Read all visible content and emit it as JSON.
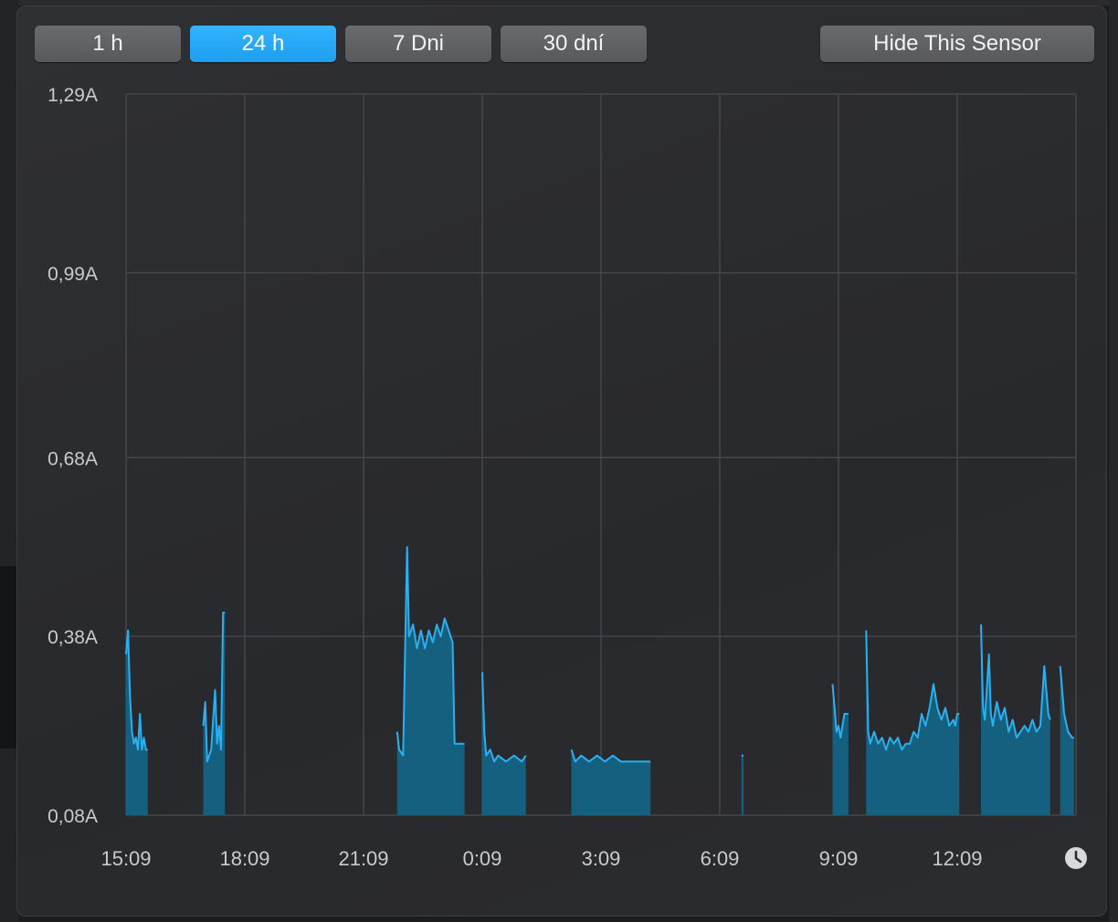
{
  "toolbar": {
    "buttons": [
      {
        "label": "1 h",
        "active": false
      },
      {
        "label": "24 h",
        "active": true
      },
      {
        "label": "7 Dni",
        "active": false
      },
      {
        "label": "30 dní",
        "active": false
      }
    ],
    "hide_label": "Hide This Sensor"
  },
  "colors": {
    "accent": "#1d9ef0",
    "series_line": "#2ab0f0",
    "series_fill": "#15607f"
  },
  "icons": {
    "history": "clock-icon"
  },
  "chart_data": {
    "type": "area",
    "title": "",
    "xlabel": "",
    "ylabel": "",
    "y_unit": "A",
    "ylim": [
      0.08,
      1.29
    ],
    "yticks": [
      {
        "value": 1.29,
        "label": "1,29A"
      },
      {
        "value": 0.99,
        "label": "0,99A"
      },
      {
        "value": 0.68,
        "label": "0,68A"
      },
      {
        "value": 0.38,
        "label": "0,38A"
      },
      {
        "value": 0.08,
        "label": "0,08A"
      }
    ],
    "x_unit": "hours",
    "xlim": [
      0,
      24
    ],
    "xticks": [
      {
        "value": 0,
        "label": "15:09"
      },
      {
        "value": 3,
        "label": "18:09"
      },
      {
        "value": 6,
        "label": "21:09"
      },
      {
        "value": 9,
        "label": "0:09"
      },
      {
        "value": 12,
        "label": "3:09"
      },
      {
        "value": 15,
        "label": "6:09"
      },
      {
        "value": 18,
        "label": "9:09"
      },
      {
        "value": 21,
        "label": "12:09"
      }
    ],
    "grid": true,
    "series": [
      {
        "segments": [
          [
            [
              0.0,
              0.35
            ],
            [
              0.05,
              0.39
            ],
            [
              0.1,
              0.28
            ],
            [
              0.15,
              0.22
            ],
            [
              0.2,
              0.2
            ],
            [
              0.25,
              0.21
            ],
            [
              0.3,
              0.19
            ],
            [
              0.35,
              0.25
            ],
            [
              0.4,
              0.19
            ],
            [
              0.45,
              0.21
            ],
            [
              0.5,
              0.19
            ],
            [
              0.55,
              0.19
            ]
          ],
          [
            [
              1.95,
              0.23
            ],
            [
              2.0,
              0.27
            ],
            [
              2.05,
              0.17
            ],
            [
              2.15,
              0.19
            ],
            [
              2.25,
              0.29
            ],
            [
              2.3,
              0.2
            ],
            [
              2.35,
              0.23
            ],
            [
              2.4,
              0.19
            ],
            [
              2.45,
              0.42
            ],
            [
              2.5,
              0.42
            ]
          ],
          [
            [
              6.85,
              0.22
            ],
            [
              6.9,
              0.19
            ],
            [
              7.0,
              0.18
            ],
            [
              7.1,
              0.53
            ],
            [
              7.15,
              0.38
            ],
            [
              7.25,
              0.4
            ],
            [
              7.35,
              0.36
            ],
            [
              7.45,
              0.39
            ],
            [
              7.55,
              0.36
            ],
            [
              7.65,
              0.39
            ],
            [
              7.75,
              0.37
            ],
            [
              7.85,
              0.4
            ],
            [
              7.95,
              0.38
            ],
            [
              8.05,
              0.41
            ],
            [
              8.15,
              0.39
            ],
            [
              8.25,
              0.37
            ],
            [
              8.3,
              0.2
            ],
            [
              8.55,
              0.2
            ]
          ],
          [
            [
              9.0,
              0.32
            ],
            [
              9.05,
              0.22
            ],
            [
              9.1,
              0.18
            ],
            [
              9.2,
              0.19
            ],
            [
              9.3,
              0.17
            ],
            [
              9.4,
              0.18
            ],
            [
              9.6,
              0.17
            ],
            [
              9.8,
              0.18
            ],
            [
              10.0,
              0.17
            ],
            [
              10.1,
              0.18
            ]
          ],
          [
            [
              11.25,
              0.19
            ],
            [
              11.35,
              0.17
            ],
            [
              11.5,
              0.18
            ],
            [
              11.7,
              0.17
            ],
            [
              11.9,
              0.18
            ],
            [
              12.1,
              0.17
            ],
            [
              12.3,
              0.18
            ],
            [
              12.5,
              0.17
            ],
            [
              12.7,
              0.17
            ],
            [
              12.9,
              0.17
            ],
            [
              13.1,
              0.17
            ],
            [
              13.25,
              0.17
            ]
          ],
          [
            [
              15.55,
              0.18
            ],
            [
              15.6,
              0.18
            ]
          ],
          [
            [
              17.85,
              0.3
            ],
            [
              17.9,
              0.26
            ],
            [
              17.95,
              0.22
            ],
            [
              18.0,
              0.23
            ],
            [
              18.05,
              0.21
            ],
            [
              18.15,
              0.25
            ],
            [
              18.25,
              0.25
            ]
          ],
          [
            [
              18.7,
              0.39
            ],
            [
              18.75,
              0.22
            ],
            [
              18.8,
              0.2
            ],
            [
              18.9,
              0.22
            ],
            [
              19.0,
              0.2
            ],
            [
              19.1,
              0.21
            ],
            [
              19.2,
              0.19
            ],
            [
              19.3,
              0.21
            ],
            [
              19.4,
              0.2
            ],
            [
              19.5,
              0.21
            ],
            [
              19.6,
              0.19
            ],
            [
              19.7,
              0.2
            ],
            [
              19.8,
              0.2
            ],
            [
              19.9,
              0.22
            ],
            [
              20.0,
              0.21
            ],
            [
              20.1,
              0.25
            ],
            [
              20.2,
              0.23
            ],
            [
              20.3,
              0.26
            ],
            [
              20.4,
              0.3
            ],
            [
              20.5,
              0.26
            ],
            [
              20.6,
              0.24
            ],
            [
              20.7,
              0.26
            ],
            [
              20.8,
              0.23
            ],
            [
              20.9,
              0.24
            ],
            [
              20.95,
              0.23
            ],
            [
              21.0,
              0.25
            ],
            [
              21.05,
              0.25
            ]
          ],
          [
            [
              21.6,
              0.4
            ],
            [
              21.65,
              0.26
            ],
            [
              21.7,
              0.24
            ],
            [
              21.8,
              0.35
            ],
            [
              21.85,
              0.25
            ],
            [
              21.9,
              0.23
            ],
            [
              22.0,
              0.27
            ],
            [
              22.1,
              0.24
            ],
            [
              22.2,
              0.26
            ],
            [
              22.3,
              0.22
            ],
            [
              22.4,
              0.24
            ],
            [
              22.5,
              0.21
            ],
            [
              22.6,
              0.22
            ],
            [
              22.7,
              0.23
            ],
            [
              22.8,
              0.22
            ],
            [
              22.9,
              0.24
            ],
            [
              23.0,
              0.22
            ],
            [
              23.1,
              0.23
            ],
            [
              23.2,
              0.33
            ],
            [
              23.3,
              0.25
            ],
            [
              23.35,
              0.24
            ]
          ],
          [
            [
              23.6,
              0.33
            ],
            [
              23.7,
              0.25
            ],
            [
              23.8,
              0.22
            ],
            [
              23.9,
              0.21
            ],
            [
              23.95,
              0.21
            ]
          ]
        ]
      }
    ]
  }
}
